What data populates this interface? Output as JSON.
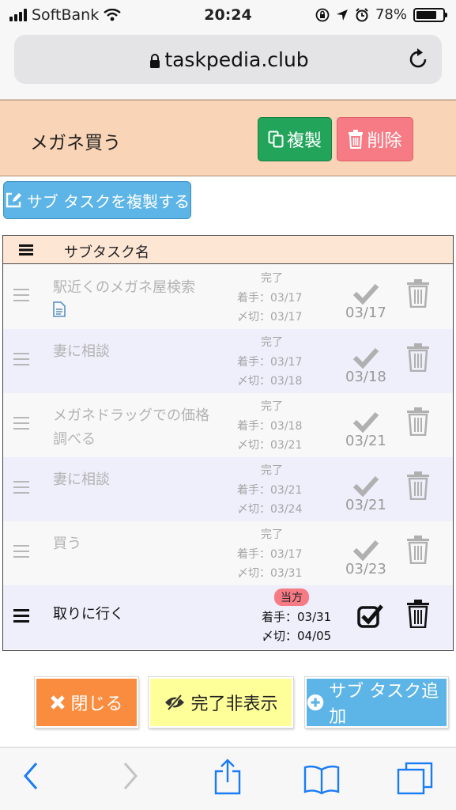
{
  "status_bar": {
    "carrier": "SoftBank",
    "time": "20:24",
    "battery": "78%",
    "battery_level": 0.78
  },
  "browser": {
    "url": "taskpedia.club"
  },
  "task": {
    "title": "メガネ買う",
    "duplicate_label": "複製",
    "delete_label": "削除"
  },
  "duplicate_subtasks_label": "サブ タスクを複製する",
  "table": {
    "header": "サブタスク名",
    "rows": [
      {
        "name": "駅近くのメガネ屋検索",
        "status": "完了",
        "start": "着手：03/17",
        "due": "〆切：03/17",
        "done": "03/17"
      },
      {
        "name": "妻に相談",
        "status": "完了",
        "start": "着手：03/17",
        "due": "〆切：03/18",
        "done": "03/18"
      },
      {
        "name": "メガネドラッグでの価格調べる",
        "status": "完了",
        "start": "着手：03/18",
        "due": "〆切：03/21",
        "done": "03/21"
      },
      {
        "name": "妻に相談",
        "status": "完了",
        "start": "着手：03/21",
        "due": "〆切：03/24",
        "done": "03/21"
      },
      {
        "name": "買う",
        "status": "完了",
        "start": "着手：03/17",
        "due": "〆切：03/31",
        "done": "03/23"
      },
      {
        "name": "取りに行く",
        "badge": "当方",
        "start": "着手：03/31",
        "due": "〆切：04/05"
      }
    ]
  },
  "footer": {
    "close_label": "閉じる",
    "hide_done_label": "完了非表示",
    "add_subtask_label": "サブ タスク追加"
  }
}
